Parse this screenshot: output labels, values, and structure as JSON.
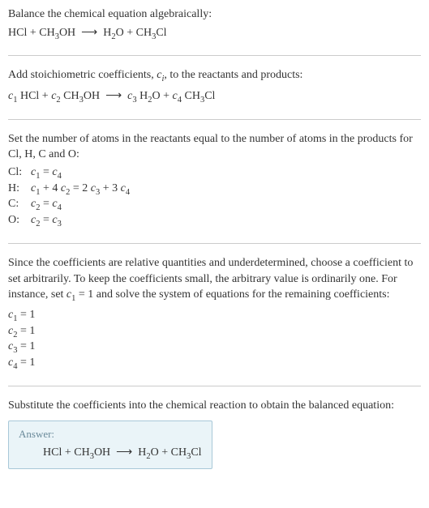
{
  "section1": {
    "title": "Balance the chemical equation algebraically:",
    "equation_html": "HCl + CH<sub>3</sub>OH&nbsp;&nbsp;⟶&nbsp;&nbsp;H<sub>2</sub>O + CH<sub>3</sub>Cl"
  },
  "section2": {
    "title_html": "Add stoichiometric coefficients, <span class='italic'>c<sub>i</sub></span>, to the reactants and products:",
    "equation_html": "<span class='italic'>c</span><sub>1</sub> HCl + <span class='italic'>c</span><sub>2</sub> CH<sub>3</sub>OH&nbsp;&nbsp;⟶&nbsp;&nbsp;<span class='italic'>c</span><sub>3</sub> H<sub>2</sub>O + <span class='italic'>c</span><sub>4</sub> CH<sub>3</sub>Cl"
  },
  "section3": {
    "title": "Set the number of atoms in the reactants equal to the number of atoms in the products for Cl, H, C and O:",
    "rows": [
      {
        "label": "Cl:",
        "eq_html": "<span class='italic'>c</span><sub>1</sub> = <span class='italic'>c</span><sub>4</sub>"
      },
      {
        "label": "H:",
        "eq_html": "<span class='italic'>c</span><sub>1</sub> + 4 <span class='italic'>c</span><sub>2</sub> = 2 <span class='italic'>c</span><sub>3</sub> + 3 <span class='italic'>c</span><sub>4</sub>"
      },
      {
        "label": "C:",
        "eq_html": "<span class='italic'>c</span><sub>2</sub> = <span class='italic'>c</span><sub>4</sub>"
      },
      {
        "label": "O:",
        "eq_html": "<span class='italic'>c</span><sub>2</sub> = <span class='italic'>c</span><sub>3</sub>"
      }
    ]
  },
  "section4": {
    "title_html": "Since the coefficients are relative quantities and underdetermined, choose a coefficient to set arbitrarily. To keep the coefficients small, the arbitrary value is ordinarily one. For instance, set <span class='italic'>c</span><sub>1</sub> = 1 and solve the system of equations for the remaining coefficients:",
    "lines": [
      "<span class='italic'>c</span><sub>1</sub> = 1",
      "<span class='italic'>c</span><sub>2</sub> = 1",
      "<span class='italic'>c</span><sub>3</sub> = 1",
      "<span class='italic'>c</span><sub>4</sub> = 1"
    ]
  },
  "section5": {
    "title": "Substitute the coefficients into the chemical reaction to obtain the balanced equation:",
    "answer_label": "Answer:",
    "answer_html": "HCl + CH<sub>3</sub>OH&nbsp;&nbsp;⟶&nbsp;&nbsp;H<sub>2</sub>O + CH<sub>3</sub>Cl"
  },
  "chart_data": {
    "type": "table",
    "title": "Balancing HCl + CH3OH -> H2O + CH3Cl algebraically",
    "unbalanced_equation": "HCl + CH3OH -> H2O + CH3Cl",
    "generic_equation": "c1 HCl + c2 CH3OH -> c3 H2O + c4 CH3Cl",
    "atom_balance_equations": {
      "Cl": "c1 = c4",
      "H": "c1 + 4 c2 = 2 c3 + 3 c4",
      "C": "c2 = c4",
      "O": "c2 = c3"
    },
    "arbitrary_choice": "c1 = 1",
    "solution": {
      "c1": 1,
      "c2": 1,
      "c3": 1,
      "c4": 1
    },
    "balanced_equation": "HCl + CH3OH -> H2O + CH3Cl"
  }
}
